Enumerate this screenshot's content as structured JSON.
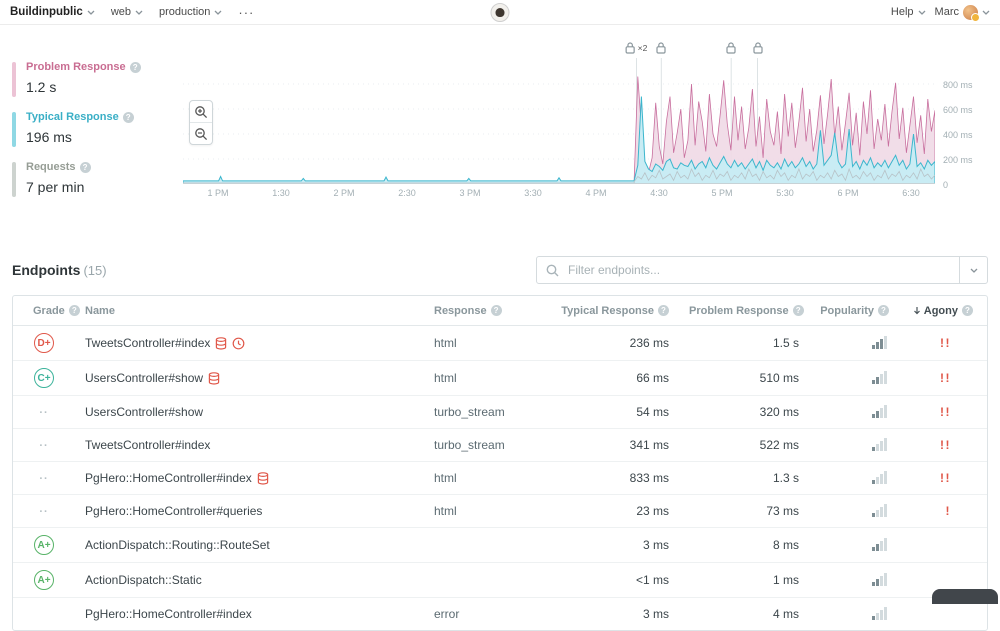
{
  "topbar": {
    "brand": "Buildinpublic",
    "menus": [
      "web",
      "production"
    ],
    "more": "···",
    "help": "Help",
    "user": "Marc"
  },
  "summary": {
    "metrics": [
      {
        "id": "problem-response",
        "label": "Problem Response",
        "value": "1.2 s",
        "color": "#c96d92",
        "bar_color": "#ecc3d5"
      },
      {
        "id": "typical-response",
        "label": "Typical Response",
        "value": "196 ms",
        "color": "#3aafc6",
        "bar_color": "#8fd8e4"
      },
      {
        "id": "requests",
        "label": "Requests",
        "value": "7 per min",
        "color": "#969d95",
        "bar_color": "#cdd3cf"
      }
    ]
  },
  "chart_data": {
    "type": "area",
    "x_ticks": [
      "1 PM",
      "1:30",
      "2 PM",
      "2:30",
      "3 PM",
      "3:30",
      "4 PM",
      "4:30",
      "5 PM",
      "5:30",
      "6 PM",
      "6:30"
    ],
    "y_ticks": [
      {
        "ms": 800,
        "label": "800 ms"
      },
      {
        "ms": 600,
        "label": "600 ms"
      },
      {
        "ms": 400,
        "label": "400 ms"
      },
      {
        "ms": 200,
        "label": "200 ms"
      },
      {
        "ms": 0,
        "label": "0"
      }
    ],
    "ylim_ms": [
      0,
      1008
    ],
    "active_start_frac": 0.6,
    "quiet_typical_ms": 25,
    "quiet_bumps": [
      {
        "frac": 0.05,
        "ms": 60
      },
      {
        "frac": 0.16,
        "ms": 45
      },
      {
        "frac": 0.27,
        "ms": 55
      },
      {
        "frac": 0.38,
        "ms": 45
      },
      {
        "frac": 0.5,
        "ms": 50
      }
    ],
    "deploys": [
      {
        "frac": 0.603,
        "label": "×2"
      },
      {
        "frac": 0.636,
        "label": ""
      },
      {
        "frac": 0.729,
        "label": ""
      },
      {
        "frac": 0.764,
        "label": ""
      }
    ],
    "series": [
      {
        "name": "Problem Response",
        "color": "#c86f9e",
        "fill": "#f0d9e6",
        "values": [
          40,
          860,
          450,
          130,
          90,
          210,
          650,
          300,
          160,
          500,
          700,
          250,
          410,
          600,
          210,
          350,
          800,
          310,
          660,
          500,
          260,
          720,
          400,
          300,
          550,
          830,
          480,
          270,
          700,
          350,
          620,
          280,
          450,
          760,
          300,
          540,
          210,
          680,
          420,
          310,
          580,
          240,
          720,
          380,
          650,
          290,
          500,
          770,
          340,
          600,
          260,
          430,
          710,
          320,
          560,
          840,
          380,
          620,
          270,
          490,
          730,
          310,
          570,
          230,
          660,
          400,
          750,
          280,
          520,
          350,
          640,
          300,
          580,
          810,
          360,
          610,
          250,
          470,
          700,
          330,
          550,
          240,
          680,
          420,
          590
        ]
      },
      {
        "name": "Typical Response",
        "color": "#3cb6cd",
        "fill": "#c9ecf4",
        "values": [
          30,
          150,
          700,
          180,
          120,
          100,
          160,
          140,
          110,
          180,
          200,
          130,
          120,
          170,
          150,
          140,
          190,
          120,
          160,
          180,
          130,
          210,
          150,
          120,
          170,
          220,
          160,
          130,
          190,
          140,
          170,
          120,
          160,
          200,
          130,
          180,
          110,
          190,
          150,
          130,
          170,
          120,
          200,
          140,
          180,
          130,
          160,
          210,
          140,
          180,
          120,
          160,
          430,
          150,
          190,
          230,
          410,
          180,
          130,
          160,
          440,
          140,
          180,
          120,
          190,
          150,
          210,
          130,
          170,
          140,
          190,
          130,
          180,
          230,
          150,
          190,
          120,
          160,
          400,
          140,
          170,
          120,
          190,
          150,
          180
        ]
      },
      {
        "name": "Requests",
        "color": "#b7c2c7",
        "fill": "none",
        "values": [
          20,
          60,
          40,
          90,
          30,
          70,
          50,
          110,
          40,
          60,
          80,
          30,
          100,
          50,
          70,
          40,
          120,
          60,
          90,
          30,
          70,
          50,
          110,
          40,
          80,
          60,
          100,
          30,
          70,
          50,
          90,
          40,
          120,
          60,
          80,
          30,
          100,
          50,
          70,
          40,
          110,
          60,
          90,
          30,
          70,
          50,
          120,
          40,
          80,
          60,
          100,
          30,
          70,
          50,
          90,
          40,
          110,
          60,
          80,
          30,
          120,
          50,
          70,
          40,
          100,
          60,
          90,
          30,
          70,
          50,
          110,
          40,
          80,
          60,
          100,
          30,
          70,
          50,
          90,
          40,
          120,
          60,
          80,
          40,
          70
        ]
      }
    ]
  },
  "endpoints": {
    "title": "Endpoints",
    "count": "(15)",
    "filter_placeholder": "Filter endpoints...",
    "columns": [
      {
        "label": "Grade",
        "help": true,
        "align": "left"
      },
      {
        "label": "Name",
        "help": false,
        "align": "left"
      },
      {
        "label": "Response",
        "help": true,
        "align": "left"
      },
      {
        "label": "Typical Response",
        "help": true,
        "align": "right"
      },
      {
        "label": "Problem Response",
        "help": true,
        "align": "right"
      },
      {
        "label": "Popularity",
        "help": true,
        "align": "right"
      },
      {
        "label": "Agony",
        "help": true,
        "align": "right",
        "sorted": "desc"
      }
    ],
    "rows": [
      {
        "grade": "D+",
        "grade_class": "d",
        "name": "TweetsController#index",
        "icons": [
          "database",
          "clock"
        ],
        "response": "html",
        "typical": "236 ms",
        "problem": "1.5 s",
        "popularity": 3,
        "agony": "!!"
      },
      {
        "grade": "C+",
        "grade_class": "c",
        "name": "UsersController#show",
        "icons": [
          "database"
        ],
        "response": "html",
        "typical": "66 ms",
        "problem": "510 ms",
        "popularity": 2,
        "agony": "!!"
      },
      {
        "grade": "··",
        "grade_class": "none",
        "name": "UsersController#show",
        "icons": [],
        "response": "turbo_stream",
        "typical": "54 ms",
        "problem": "320 ms",
        "popularity": 2,
        "agony": "!!"
      },
      {
        "grade": "··",
        "grade_class": "none",
        "name": "TweetsController#index",
        "icons": [],
        "response": "turbo_stream",
        "typical": "341 ms",
        "problem": "522 ms",
        "popularity": 1,
        "agony": "!!"
      },
      {
        "grade": "··",
        "grade_class": "none",
        "name": "PgHero::HomeController#index",
        "icons": [
          "database"
        ],
        "response": "html",
        "typical": "833 ms",
        "problem": "1.3 s",
        "popularity": 1,
        "agony": "!!"
      },
      {
        "grade": "··",
        "grade_class": "none",
        "name": "PgHero::HomeController#queries",
        "icons": [],
        "response": "html",
        "typical": "23 ms",
        "problem": "73 ms",
        "popularity": 1,
        "agony": "!"
      },
      {
        "grade": "A+",
        "grade_class": "a",
        "name": "ActionDispatch::Routing::RouteSet",
        "icons": [],
        "response": "",
        "typical": "3 ms",
        "problem": "8 ms",
        "popularity": 2,
        "agony": ""
      },
      {
        "grade": "A+",
        "grade_class": "a",
        "name": "ActionDispatch::Static",
        "icons": [],
        "response": "",
        "typical": "<1 ms",
        "problem": "1 ms",
        "popularity": 2,
        "agony": ""
      },
      {
        "grade": "",
        "grade_class": "none",
        "name": "PgHero::HomeController#index",
        "icons": [],
        "response": "error",
        "typical": "3 ms",
        "problem": "4 ms",
        "popularity": 1,
        "agony": ""
      }
    ]
  },
  "colors": {
    "grade_a": "#58b368",
    "grade_c": "#3cb39b",
    "grade_d": "#e0584a",
    "agony": "#e0584a",
    "icon_red": "#e0584a",
    "pop_dark": "#7d8d93",
    "pop_light": "#d3dbde"
  }
}
